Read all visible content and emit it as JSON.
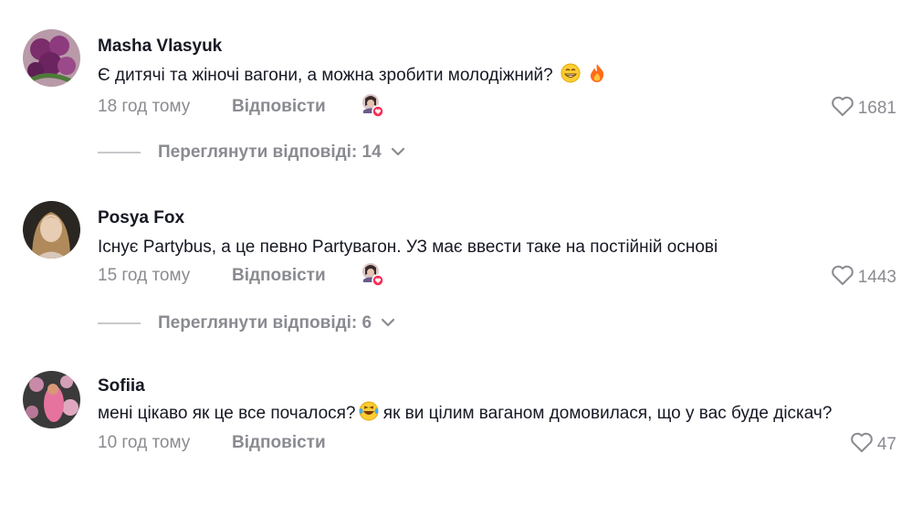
{
  "comments": [
    {
      "author": "Masha Vlasyuk",
      "text": "Є дитячі та жіночі вагони, а можна зробити молодіжний?",
      "emojis": [
        "grinning-face-icon",
        "fire-icon"
      ],
      "time": "18 год тому",
      "reply_label": "Відповісти",
      "likes": "1681",
      "creator_liked": true,
      "view_replies": "Переглянути відповіді: 14",
      "avatar": "tulips-avatar"
    },
    {
      "author": "Posya Fox",
      "text": "Існує Partybus, а це певно Partyвагон. УЗ має ввести таке на постійній основі",
      "time": "15 год тому",
      "reply_label": "Відповісти",
      "likes": "1443",
      "creator_liked": true,
      "view_replies": "Переглянути відповіді: 6",
      "avatar": "woman-portrait-avatar"
    },
    {
      "author": "Sofiia",
      "text_part1": "мені цікаво як це все почалося?",
      "text_part2": " як ви цілим ваганом домовилася, що у вас буде діскач?",
      "emojis": [
        "laughing-tears-icon"
      ],
      "time": "10 год тому",
      "reply_label": "Відповісти",
      "likes": "47",
      "creator_liked": false,
      "avatar": "pink-flowers-avatar"
    }
  ],
  "colors": {
    "text": "#161823",
    "muted": "#8a8b91",
    "like_badge": "#fe2c55"
  }
}
